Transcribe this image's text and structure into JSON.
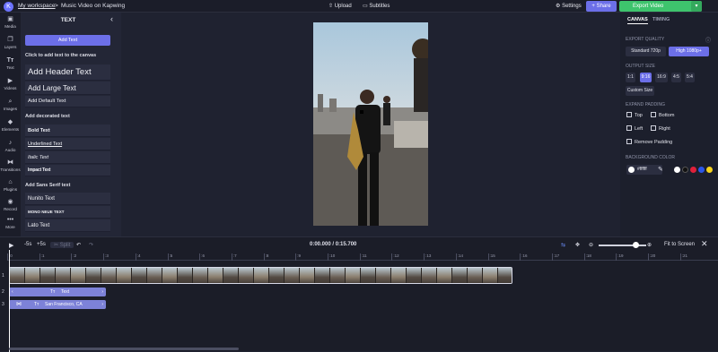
{
  "topbar": {
    "workspace": "My workspace",
    "separator": ">",
    "project_title": "Music Video on Kapwing",
    "upload": "Upload",
    "subtitles": "Subtitles",
    "settings": "Settings",
    "share": "Share",
    "export": "Export Video",
    "logo_icon": "kapwing-logo",
    "upload_icon": "upload-icon",
    "subtitles_icon": "subtitles-icon",
    "settings_icon": "gear-icon",
    "share_icon": "user-plus-icon",
    "export_caret_icon": "chevron-down-icon"
  },
  "rail": [
    {
      "label": "Media",
      "icon": "media-icon"
    },
    {
      "label": "Layers",
      "icon": "layers-icon"
    },
    {
      "label": "Text",
      "icon": "text-icon"
    },
    {
      "label": "Videos",
      "icon": "video-icon"
    },
    {
      "label": "Images",
      "icon": "search-icon"
    },
    {
      "label": "Elements",
      "icon": "elements-icon"
    },
    {
      "label": "Audio",
      "icon": "music-icon"
    },
    {
      "label": "Transitions",
      "icon": "transitions-icon"
    },
    {
      "label": "Plugins",
      "icon": "plugins-icon"
    },
    {
      "label": "Record",
      "icon": "record-icon"
    },
    {
      "label": "More",
      "icon": "more-icon"
    }
  ],
  "text_panel": {
    "title": "TEXT",
    "add_button": "Add Text",
    "hint": "Click to add text to the canvas",
    "options": [
      "Add Header Text",
      "Add Large Text",
      "Add Default Text"
    ],
    "decorated_label": "Add decorated text",
    "decorated": [
      "Bold Text",
      "Underlined Text",
      "Italic Text",
      "Impact Text"
    ],
    "sans_label": "Add Sans Serif text",
    "sans": [
      "Nunito Text",
      "MONO NEUE TEXT",
      "Lato Text"
    ]
  },
  "right_panel": {
    "tabs": [
      "CANVAS",
      "TIMING"
    ],
    "export_quality_label": "EXPORT QUALITY",
    "quality": [
      "Standard 720p",
      "High 1080p+"
    ],
    "output_size_label": "OUTPUT SIZE",
    "sizes": [
      "1:1",
      "9:16",
      "16:9",
      "4:5",
      "5:4"
    ],
    "custom_size": "Custom Size",
    "expand_padding_label": "EXPAND PADDING",
    "padding": [
      "Top",
      "Bottom",
      "Left",
      "Right"
    ],
    "remove_padding": "Remove Padding",
    "background_label": "BACKGROUND COLOR",
    "bg_value": "#ffffff",
    "swatches": [
      "#ffffff",
      "#111111",
      "#e0203a",
      "#2c57e8",
      "#f6d31c",
      "#e6e7ee"
    ]
  },
  "timeline": {
    "minus5": "-5s",
    "plus5": "+5s",
    "split": "Split",
    "time": "0:00.000 / 0:15.700",
    "fit": "Fit to Screen",
    "ticks": [
      ":0",
      ":1",
      ":2",
      ":3",
      ":4",
      ":5",
      ":6",
      ":7",
      ":8",
      ":9",
      ":10",
      ":11",
      ":12",
      ":13",
      ":14",
      ":15",
      ":16",
      ":17",
      ":18",
      ":19",
      ":20",
      ":21"
    ],
    "tracks": [
      "1",
      "2",
      "3"
    ],
    "text_clip": "Text",
    "location_clip": "San Francisco, CA",
    "zoom_fraction": 0.78
  }
}
